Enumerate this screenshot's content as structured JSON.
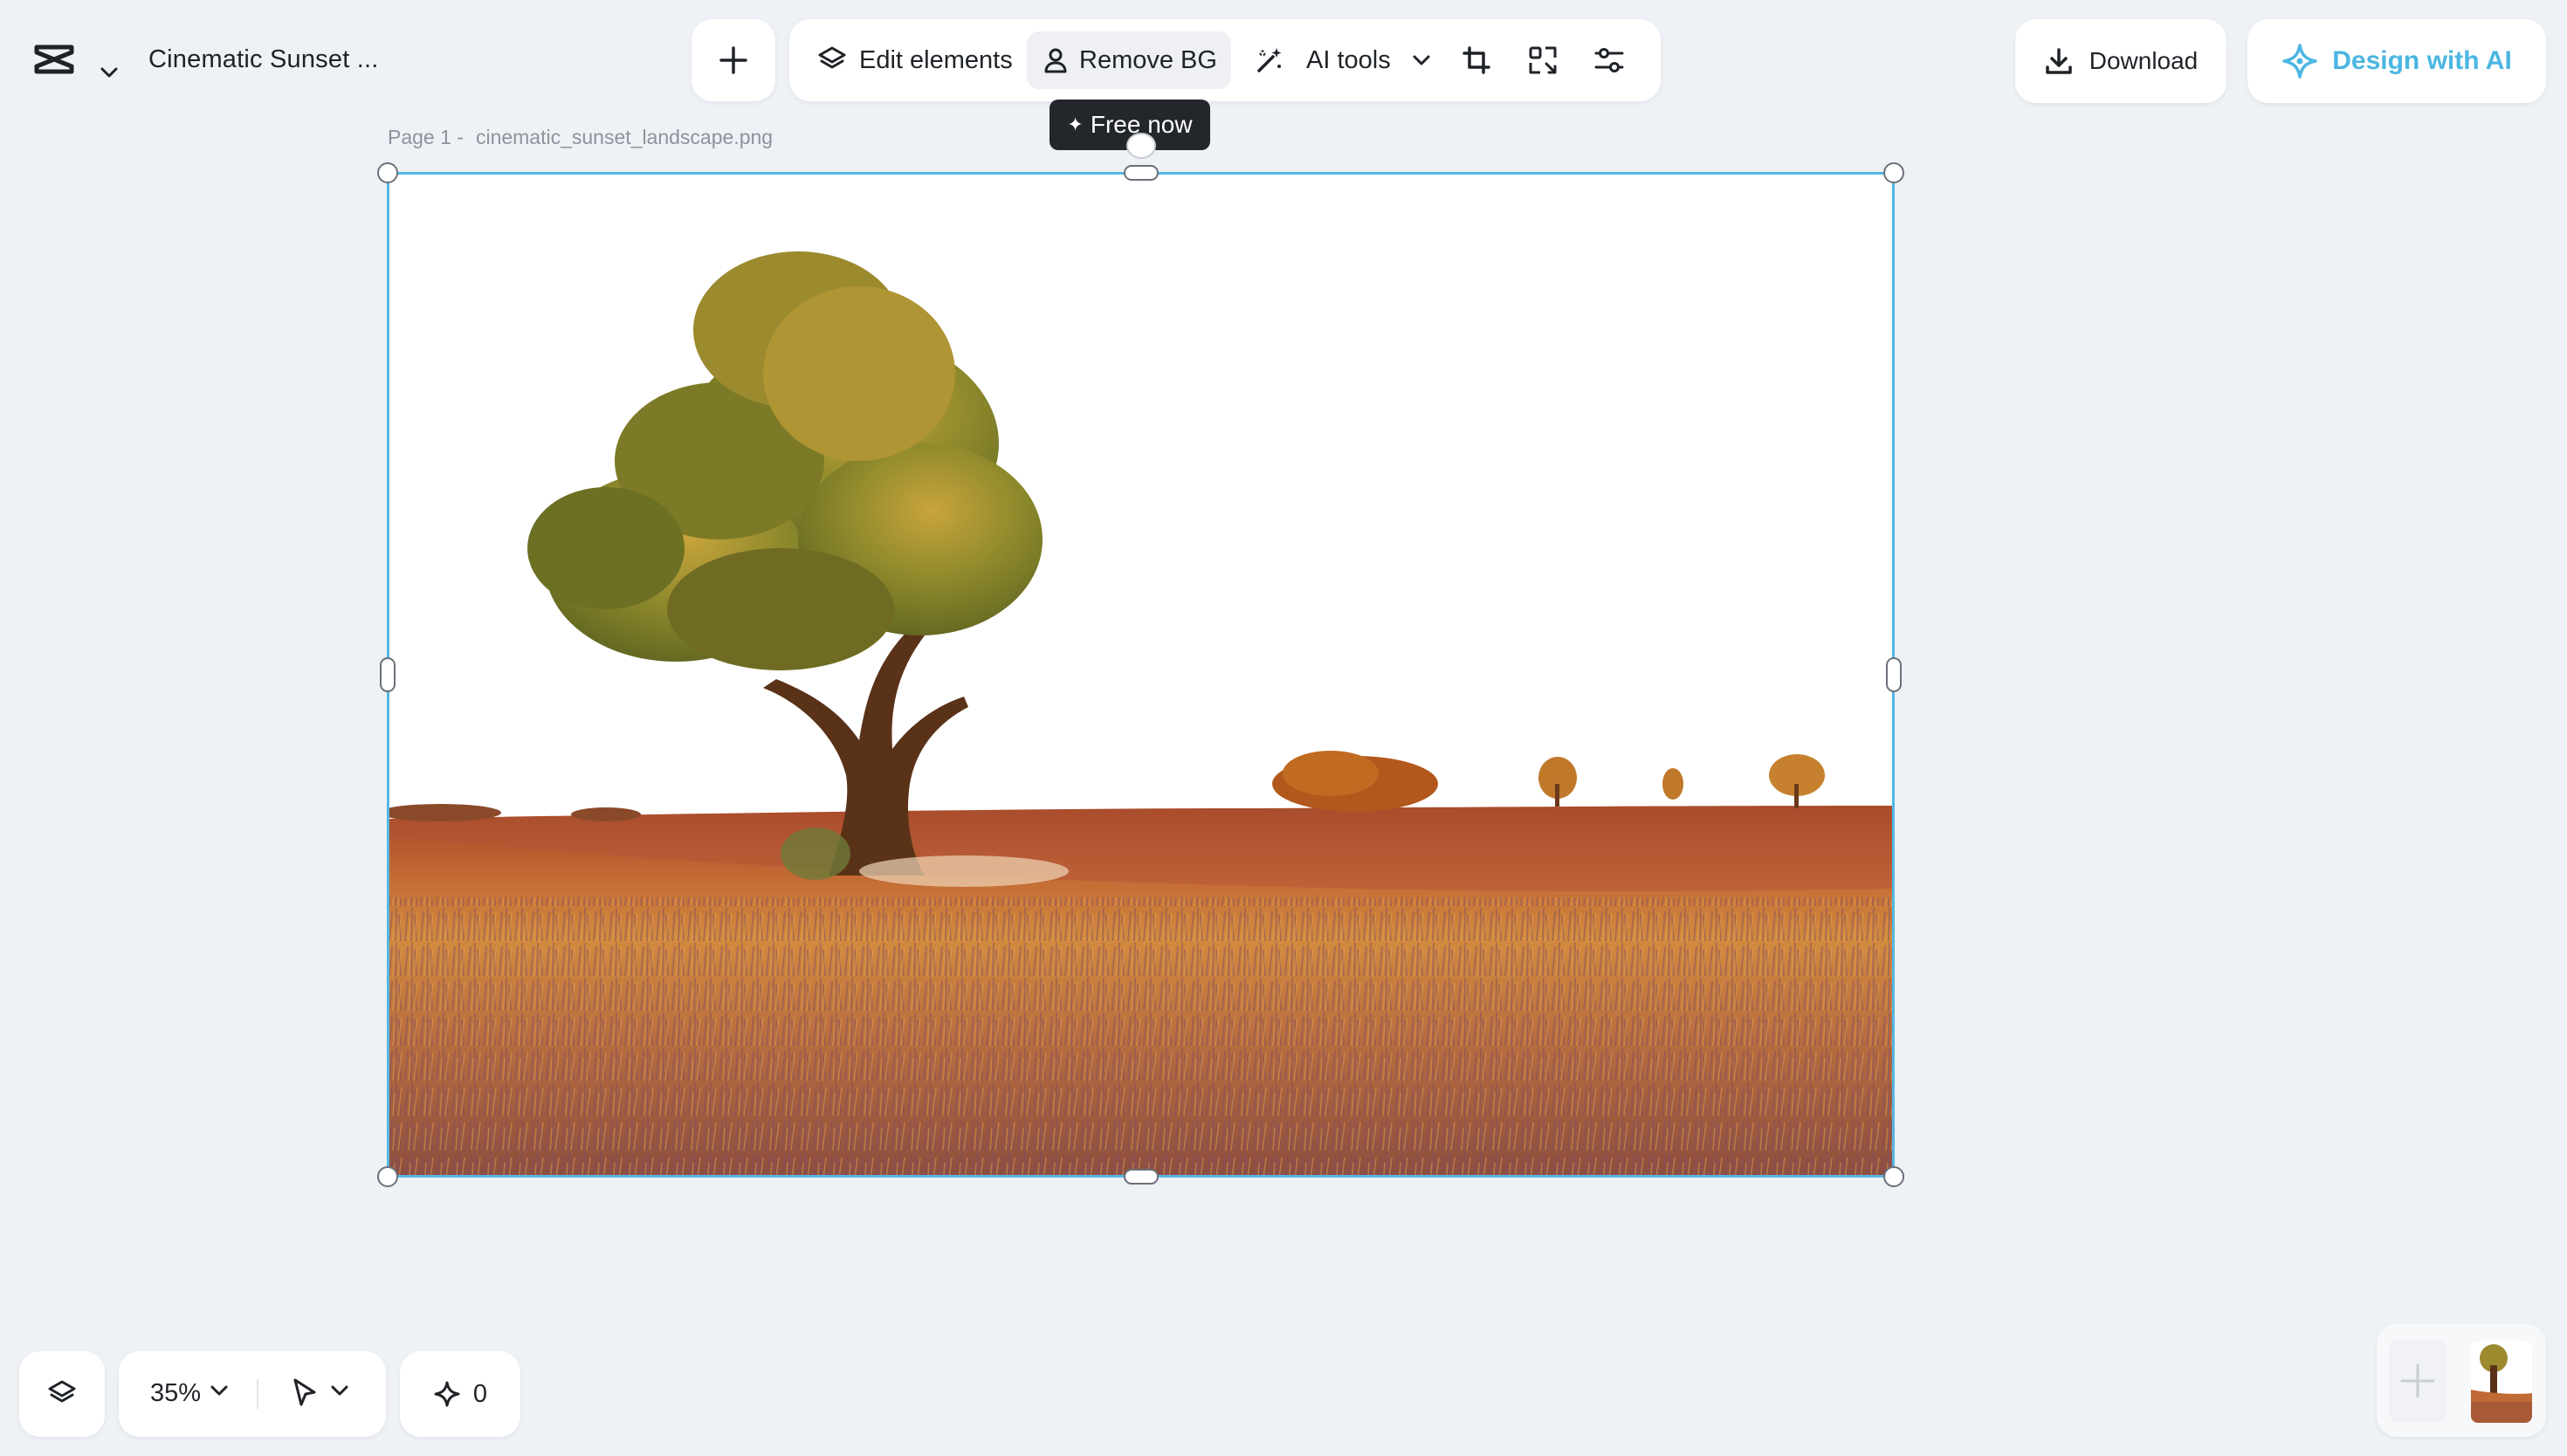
{
  "project": {
    "title": "Cinematic Sunset ..."
  },
  "toolbar": {
    "edit_elements": "Edit elements",
    "remove_bg": "Remove BG",
    "ai_tools": "AI tools"
  },
  "tooltip": {
    "text": "Free now"
  },
  "actions": {
    "download": "Download",
    "design_with_ai": "Design with AI"
  },
  "page": {
    "label": "Page 1 -",
    "filename": "cinematic_sunset_landscape.png"
  },
  "bottom": {
    "zoom": "35%",
    "credits": "0"
  },
  "icons": {
    "logo": "capcut-logo-icon",
    "add": "plus-icon",
    "edit_elements": "layers-icon",
    "remove_bg": "person-icon",
    "ai_tools": "magic-wand-icon",
    "crop": "crop-icon",
    "resize": "resize-icon",
    "adjust": "sliders-icon",
    "download": "download-icon",
    "design_ai": "ai-sparkle-icon"
  },
  "colors": {
    "accent": "#4bb6e2",
    "selection": "#53b8e4",
    "background": "#eef1f5",
    "tooltip_bg": "#23262b"
  }
}
